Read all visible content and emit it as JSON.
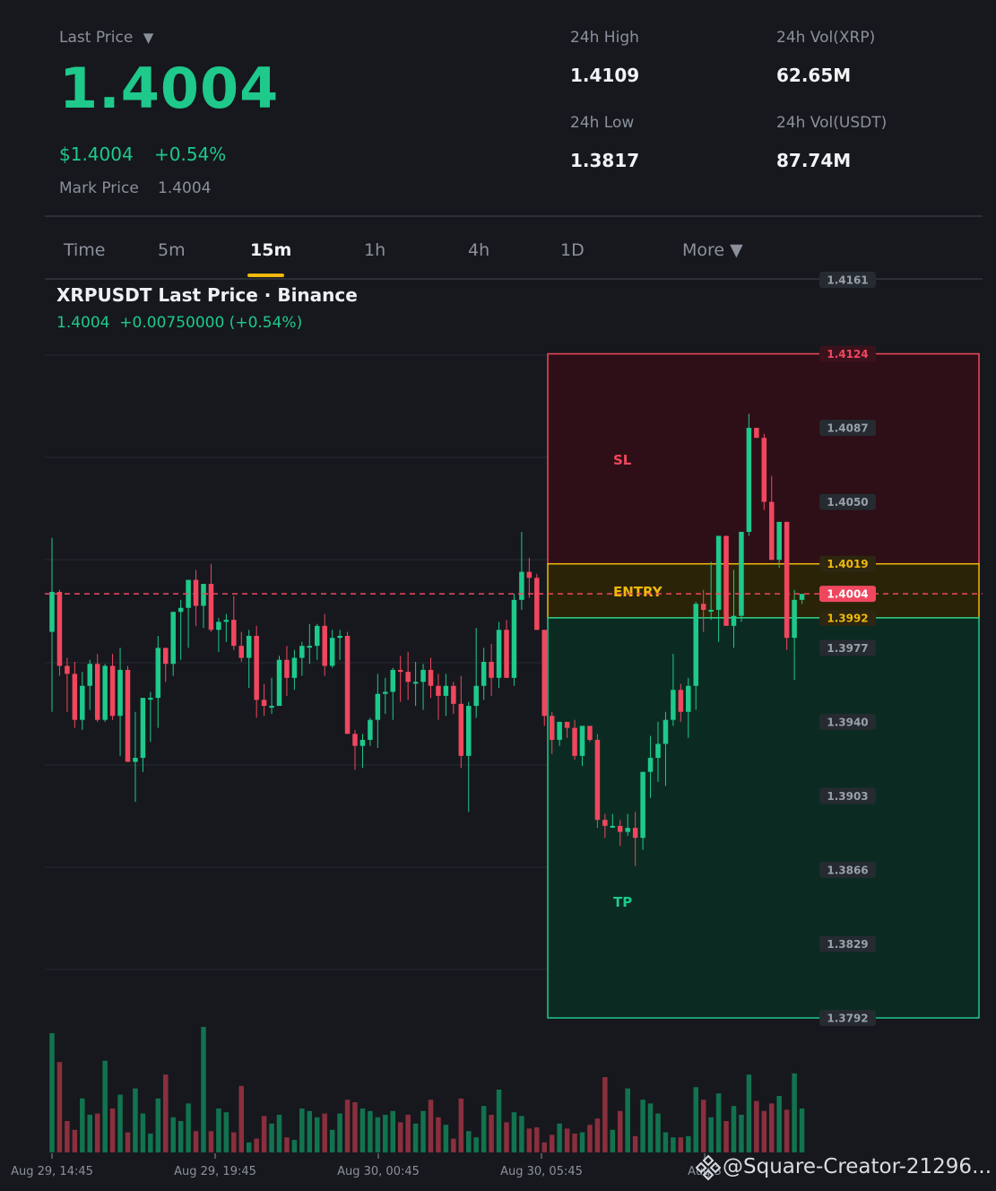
{
  "header": {
    "last_price_label": "Last Price",
    "dropdown_glyph": "▼",
    "last_price": "1.4004",
    "usd_price": "$1.4004",
    "change_pct": "+0.54%",
    "mark_price_label": "Mark Price",
    "mark_price": "1.4004",
    "stats": [
      {
        "label": "24h High",
        "value": "1.4109"
      },
      {
        "label": "24h Vol(XRP)",
        "value": "62.65M"
      },
      {
        "label": "24h Low",
        "value": "1.3817"
      },
      {
        "label": "24h Vol(USDT)",
        "value": "87.74M"
      }
    ]
  },
  "tabs": [
    "Time",
    "5m",
    "15m",
    "1h",
    "4h",
    "1D",
    "More ▼"
  ],
  "active_tab": "15m",
  "chart_title": "XRPUSDT Last Price · Binance",
  "chart_subtitle": "1.4004  +0.00750000 (+0.54%)",
  "watermark": "@Square-Creator-21296...",
  "colors": {
    "up": "#1ec98b",
    "down": "#f0475f",
    "accent": "#f0b90b",
    "sl_zone": "#2e0f17",
    "entry_zone": "#2b2308",
    "tp_zone": "#0b2b22"
  },
  "chart_data": {
    "type": "candlestick",
    "symbol": "XRPUSDT",
    "y_ticks": [
      1.4161,
      1.4087,
      1.405,
      1.4019,
      1.4004,
      1.3992,
      1.3977,
      1.394,
      1.3903,
      1.3866,
      1.3829,
      1.3792
    ],
    "x_ticks": [
      "Aug 29, 14:45",
      "Aug 29, 19:45",
      "Aug 30, 00:45",
      "Aug 30, 05:45",
      "Aug 3"
    ],
    "levels": {
      "sl": 1.4124,
      "entry": 1.4019,
      "current": 1.4004,
      "breakeven": 1.3992
    },
    "zone_labels": {
      "sl": "SL",
      "entry": "ENTRY",
      "tp": "TP"
    },
    "candles": [
      {
        "o": 1.3985,
        "h": 1.4032,
        "l": 1.3945,
        "c": 1.4005,
        "v": 95
      },
      {
        "o": 1.4005,
        "h": 1.4006,
        "l": 1.3963,
        "c": 1.3968,
        "v": 72
      },
      {
        "o": 1.3968,
        "h": 1.3972,
        "l": 1.3945,
        "c": 1.3964,
        "v": 25
      },
      {
        "o": 1.3964,
        "h": 1.397,
        "l": 1.3937,
        "c": 1.3941,
        "v": 18
      },
      {
        "o": 1.3941,
        "h": 1.3965,
        "l": 1.3936,
        "c": 1.3958,
        "v": 43
      },
      {
        "o": 1.3958,
        "h": 1.3971,
        "l": 1.3946,
        "c": 1.3969,
        "v": 30
      },
      {
        "o": 1.3969,
        "h": 1.3974,
        "l": 1.394,
        "c": 1.3941,
        "v": 31
      },
      {
        "o": 1.3941,
        "h": 1.3969,
        "l": 1.394,
        "c": 1.3968,
        "v": 73
      },
      {
        "o": 1.3968,
        "h": 1.3974,
        "l": 1.3941,
        "c": 1.3943,
        "v": 35
      },
      {
        "o": 1.3943,
        "h": 1.3977,
        "l": 1.3923,
        "c": 1.3966,
        "v": 46
      },
      {
        "o": 1.3966,
        "h": 1.3968,
        "l": 1.392,
        "c": 1.392,
        "v": 16
      },
      {
        "o": 1.392,
        "h": 1.3945,
        "l": 1.39,
        "c": 1.3922,
        "v": 51
      },
      {
        "o": 1.3922,
        "h": 1.3945,
        "l": 1.3915,
        "c": 1.3952,
        "v": 31
      },
      {
        "o": 1.3952,
        "h": 1.3955,
        "l": 1.393,
        "c": 1.3952,
        "v": 15
      },
      {
        "o": 1.3952,
        "h": 1.3983,
        "l": 1.3937,
        "c": 1.3977,
        "v": 43
      },
      {
        "o": 1.3977,
        "h": 1.3976,
        "l": 1.396,
        "c": 1.3969,
        "v": 62
      },
      {
        "o": 1.3969,
        "h": 1.3991,
        "l": 1.3963,
        "c": 1.3995,
        "v": 28
      },
      {
        "o": 1.3995,
        "h": 1.4001,
        "l": 1.3971,
        "c": 1.3997,
        "v": 25
      },
      {
        "o": 1.3997,
        "h": 1.4007,
        "l": 1.3977,
        "c": 1.4011,
        "v": 39
      },
      {
        "o": 1.4011,
        "h": 1.4016,
        "l": 1.3988,
        "c": 1.3998,
        "v": 17
      },
      {
        "o": 1.3998,
        "h": 1.4009,
        "l": 1.3987,
        "c": 1.4009,
        "v": 100
      },
      {
        "o": 1.4009,
        "h": 1.4019,
        "l": 1.3985,
        "c": 1.3986,
        "v": 17
      },
      {
        "o": 1.3986,
        "h": 1.3992,
        "l": 1.3975,
        "c": 1.399,
        "v": 35
      },
      {
        "o": 1.399,
        "h": 1.3994,
        "l": 1.398,
        "c": 1.3991,
        "v": 32
      },
      {
        "o": 1.3991,
        "h": 1.4003,
        "l": 1.3976,
        "c": 1.3978,
        "v": 16
      },
      {
        "o": 1.3978,
        "h": 1.3985,
        "l": 1.397,
        "c": 1.3972,
        "v": 53
      },
      {
        "o": 1.3972,
        "h": 1.3986,
        "l": 1.3957,
        "c": 1.3983,
        "v": 8
      },
      {
        "o": 1.3983,
        "h": 1.3988,
        "l": 1.3942,
        "c": 1.3951,
        "v": 11
      },
      {
        "o": 1.3951,
        "h": 1.3959,
        "l": 1.3943,
        "c": 1.3948,
        "v": 29
      },
      {
        "o": 1.3948,
        "h": 1.3962,
        "l": 1.3944,
        "c": 1.3948,
        "v": 23
      },
      {
        "o": 1.3948,
        "h": 1.3973,
        "l": 1.3949,
        "c": 1.3971,
        "v": 30
      },
      {
        "o": 1.3971,
        "h": 1.3978,
        "l": 1.3953,
        "c": 1.3962,
        "v": 12
      },
      {
        "o": 1.3962,
        "h": 1.3976,
        "l": 1.3956,
        "c": 1.3972,
        "v": 10
      },
      {
        "o": 1.3972,
        "h": 1.398,
        "l": 1.3963,
        "c": 1.3978,
        "v": 35
      },
      {
        "o": 1.3978,
        "h": 1.3989,
        "l": 1.3969,
        "c": 1.3978,
        "v": 33
      },
      {
        "o": 1.3978,
        "h": 1.3989,
        "l": 1.3971,
        "c": 1.3988,
        "v": 28
      },
      {
        "o": 1.3988,
        "h": 1.3994,
        "l": 1.3963,
        "c": 1.3968,
        "v": 31
      },
      {
        "o": 1.3968,
        "h": 1.3986,
        "l": 1.3967,
        "c": 1.3982,
        "v": 18
      },
      {
        "o": 1.3982,
        "h": 1.3986,
        "l": 1.3971,
        "c": 1.3983,
        "v": 31
      },
      {
        "o": 1.3983,
        "h": 1.3985,
        "l": 1.3934,
        "c": 1.3934,
        "v": 42
      },
      {
        "o": 1.3934,
        "h": 1.3936,
        "l": 1.3916,
        "c": 1.3928,
        "v": 40
      },
      {
        "o": 1.3928,
        "h": 1.3934,
        "l": 1.3917,
        "c": 1.3931,
        "v": 35
      },
      {
        "o": 1.3931,
        "h": 1.3942,
        "l": 1.3928,
        "c": 1.3941,
        "v": 33
      },
      {
        "o": 1.3941,
        "h": 1.3964,
        "l": 1.3927,
        "c": 1.3954,
        "v": 28
      },
      {
        "o": 1.3954,
        "h": 1.3962,
        "l": 1.3944,
        "c": 1.3955,
        "v": 30
      },
      {
        "o": 1.3955,
        "h": 1.3967,
        "l": 1.3941,
        "c": 1.3966,
        "v": 33
      },
      {
        "o": 1.3966,
        "h": 1.3973,
        "l": 1.395,
        "c": 1.3965,
        "v": 24
      },
      {
        "o": 1.3965,
        "h": 1.3975,
        "l": 1.3951,
        "c": 1.396,
        "v": 30
      },
      {
        "o": 1.396,
        "h": 1.397,
        "l": 1.3948,
        "c": 1.396,
        "v": 23
      },
      {
        "o": 1.396,
        "h": 1.3969,
        "l": 1.3946,
        "c": 1.3966,
        "v": 33
      },
      {
        "o": 1.3966,
        "h": 1.3972,
        "l": 1.3952,
        "c": 1.3958,
        "v": 42
      },
      {
        "o": 1.3958,
        "h": 1.3964,
        "l": 1.3941,
        "c": 1.3953,
        "v": 28
      },
      {
        "o": 1.3953,
        "h": 1.3964,
        "l": 1.3943,
        "c": 1.3958,
        "v": 22
      },
      {
        "o": 1.3958,
        "h": 1.396,
        "l": 1.3944,
        "c": 1.3949,
        "v": 11
      },
      {
        "o": 1.3949,
        "h": 1.3963,
        "l": 1.3917,
        "c": 1.3923,
        "v": 43
      },
      {
        "o": 1.3923,
        "h": 1.395,
        "l": 1.3895,
        "c": 1.3948,
        "v": 17
      },
      {
        "o": 1.3948,
        "h": 1.3987,
        "l": 1.3942,
        "c": 1.3958,
        "v": 12
      },
      {
        "o": 1.3958,
        "h": 1.3977,
        "l": 1.3951,
        "c": 1.397,
        "v": 37
      },
      {
        "o": 1.397,
        "h": 1.3979,
        "l": 1.3953,
        "c": 1.3962,
        "v": 30
      },
      {
        "o": 1.3962,
        "h": 1.399,
        "l": 1.3957,
        "c": 1.3986,
        "v": 50
      },
      {
        "o": 1.3986,
        "h": 1.3991,
        "l": 1.3962,
        "c": 1.3962,
        "v": 24
      },
      {
        "o": 1.3962,
        "h": 1.4004,
        "l": 1.3958,
        "c": 1.4001,
        "v": 32
      },
      {
        "o": 1.4001,
        "h": 1.4035,
        "l": 1.3996,
        "c": 1.4015,
        "v": 29
      },
      {
        "o": 1.4015,
        "h": 1.4022,
        "l": 1.4002,
        "c": 1.4012,
        "v": 19
      },
      {
        "o": 1.4012,
        "h": 1.4014,
        "l": 1.3986,
        "c": 1.3986,
        "v": 20
      },
      {
        "o": 1.3986,
        "h": 1.3985,
        "l": 1.3938,
        "c": 1.3943,
        "v": 8
      },
      {
        "o": 1.3943,
        "h": 1.3945,
        "l": 1.3924,
        "c": 1.3931,
        "v": 14
      },
      {
        "o": 1.3931,
        "h": 1.394,
        "l": 1.3928,
        "c": 1.394,
        "v": 23
      },
      {
        "o": 1.394,
        "h": 1.394,
        "l": 1.3932,
        "c": 1.3937,
        "v": 19
      },
      {
        "o": 1.3937,
        "h": 1.3941,
        "l": 1.3921,
        "c": 1.3923,
        "v": 15
      },
      {
        "o": 1.3923,
        "h": 1.3938,
        "l": 1.3918,
        "c": 1.3938,
        "v": 16
      },
      {
        "o": 1.3938,
        "h": 1.3938,
        "l": 1.393,
        "c": 1.3931,
        "v": 22
      },
      {
        "o": 1.3931,
        "h": 1.3934,
        "l": 1.3887,
        "c": 1.3891,
        "v": 27
      },
      {
        "o": 1.3891,
        "h": 1.3894,
        "l": 1.3882,
        "c": 1.3888,
        "v": 60
      },
      {
        "o": 1.3888,
        "h": 1.3894,
        "l": 1.3887,
        "c": 1.3888,
        "v": 18
      },
      {
        "o": 1.3888,
        "h": 1.3891,
        "l": 1.3878,
        "c": 1.3885,
        "v": 33
      },
      {
        "o": 1.3885,
        "h": 1.3894,
        "l": 1.3883,
        "c": 1.3887,
        "v": 51
      },
      {
        "o": 1.3887,
        "h": 1.3895,
        "l": 1.3868,
        "c": 1.3882,
        "v": 13
      },
      {
        "o": 1.3882,
        "h": 1.3913,
        "l": 1.3876,
        "c": 1.3915,
        "v": 42
      },
      {
        "o": 1.3915,
        "h": 1.3933,
        "l": 1.3902,
        "c": 1.3922,
        "v": 39
      },
      {
        "o": 1.3922,
        "h": 1.394,
        "l": 1.391,
        "c": 1.3929,
        "v": 31
      },
      {
        "o": 1.3929,
        "h": 1.3945,
        "l": 1.3908,
        "c": 1.3941,
        "v": 16
      },
      {
        "o": 1.3941,
        "h": 1.3974,
        "l": 1.3938,
        "c": 1.3956,
        "v": 12
      },
      {
        "o": 1.3956,
        "h": 1.3959,
        "l": 1.394,
        "c": 1.3945,
        "v": 12
      },
      {
        "o": 1.3945,
        "h": 1.3962,
        "l": 1.3932,
        "c": 1.3958,
        "v": 13
      },
      {
        "o": 1.3958,
        "h": 1.4,
        "l": 1.3946,
        "c": 1.3999,
        "v": 52
      },
      {
        "o": 1.3999,
        "h": 1.4006,
        "l": 1.3985,
        "c": 1.3996,
        "v": 42
      },
      {
        "o": 1.3996,
        "h": 1.402,
        "l": 1.3991,
        "c": 1.3996,
        "v": 28
      },
      {
        "o": 1.3996,
        "h": 1.4033,
        "l": 1.398,
        "c": 1.4033,
        "v": 47
      },
      {
        "o": 1.4033,
        "h": 1.4033,
        "l": 1.399,
        "c": 1.3988,
        "v": 25
      },
      {
        "o": 1.3988,
        "h": 1.4016,
        "l": 1.3977,
        "c": 1.3993,
        "v": 37
      },
      {
        "o": 1.3993,
        "h": 1.4028,
        "l": 1.399,
        "c": 1.4035,
        "v": 30
      },
      {
        "o": 1.4035,
        "h": 1.4094,
        "l": 1.4033,
        "c": 1.4087,
        "v": 62
      },
      {
        "o": 1.4087,
        "h": 1.4087,
        "l": 1.4082,
        "c": 1.4082,
        "v": 41
      },
      {
        "o": 1.4082,
        "h": 1.4084,
        "l": 1.4046,
        "c": 1.405,
        "v": 33
      },
      {
        "o": 1.405,
        "h": 1.4063,
        "l": 1.4021,
        "c": 1.4021,
        "v": 39
      },
      {
        "o": 1.4021,
        "h": 1.4039,
        "l": 1.4017,
        "c": 1.404,
        "v": 45
      },
      {
        "o": 1.404,
        "h": 1.404,
        "l": 1.3976,
        "c": 1.3982,
        "v": 34
      },
      {
        "o": 1.3982,
        "h": 1.4006,
        "l": 1.3961,
        "c": 1.4001,
        "v": 63
      },
      {
        "o": 1.4001,
        "h": 1.4003,
        "l": 1.3999,
        "c": 1.4004,
        "v": 35
      }
    ]
  }
}
